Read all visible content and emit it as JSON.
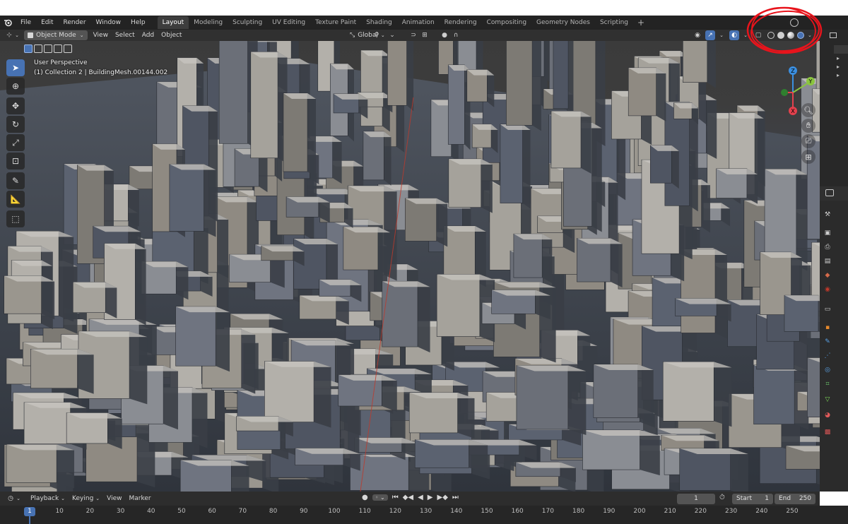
{
  "menubar": {
    "menus": [
      "File",
      "Edit",
      "Render",
      "Window",
      "Help"
    ],
    "workspaces": [
      "Layout",
      "Modeling",
      "Sculpting",
      "UV Editing",
      "Texture Paint",
      "Shading",
      "Animation",
      "Rendering",
      "Compositing",
      "Geometry Nodes",
      "Scripting"
    ],
    "active_workspace": "Layout",
    "add_tab": "+"
  },
  "header": {
    "mode": "Object Mode",
    "menus": [
      "View",
      "Select",
      "Add",
      "Object"
    ],
    "transform_orientation": "Global"
  },
  "viewport": {
    "perspective": "User Perspective",
    "object_info": "(1) Collection 2 | BuildingMesh.00144.002",
    "gizmo": {
      "x": "X",
      "y": "Y",
      "z": "Z"
    }
  },
  "timeline": {
    "menus": [
      "Playback",
      "Keying",
      "View",
      "Marker"
    ],
    "current_frame": "1",
    "start_label": "Start",
    "start_value": "1",
    "end_label": "End",
    "end_value": "250",
    "ticks": [
      "10",
      "20",
      "30",
      "40",
      "50",
      "60",
      "70",
      "80",
      "90",
      "100",
      "110",
      "120",
      "130",
      "140",
      "150",
      "160",
      "170",
      "180",
      "190",
      "200",
      "210",
      "220",
      "230",
      "240",
      "250"
    ],
    "playhead": "1"
  },
  "colors": {
    "accent": "#4772b3",
    "annotation": "#e8141c",
    "x_axis": "#e4414d",
    "y_axis": "#8bc53f",
    "z_axis": "#3b8fe0"
  },
  "icons": {
    "tools": [
      "cursor-select-icon",
      "3d-cursor-icon",
      "move-icon",
      "rotate-icon",
      "scale-icon",
      "transform-icon",
      "annotate-icon",
      "measure-icon",
      "add-cube-icon"
    ],
    "navigation": [
      "zoom-icon",
      "hand-pan-icon",
      "camera-icon",
      "grid-view-icon"
    ],
    "shading_modes": [
      "wireframe",
      "solid",
      "material-preview",
      "rendered"
    ]
  }
}
